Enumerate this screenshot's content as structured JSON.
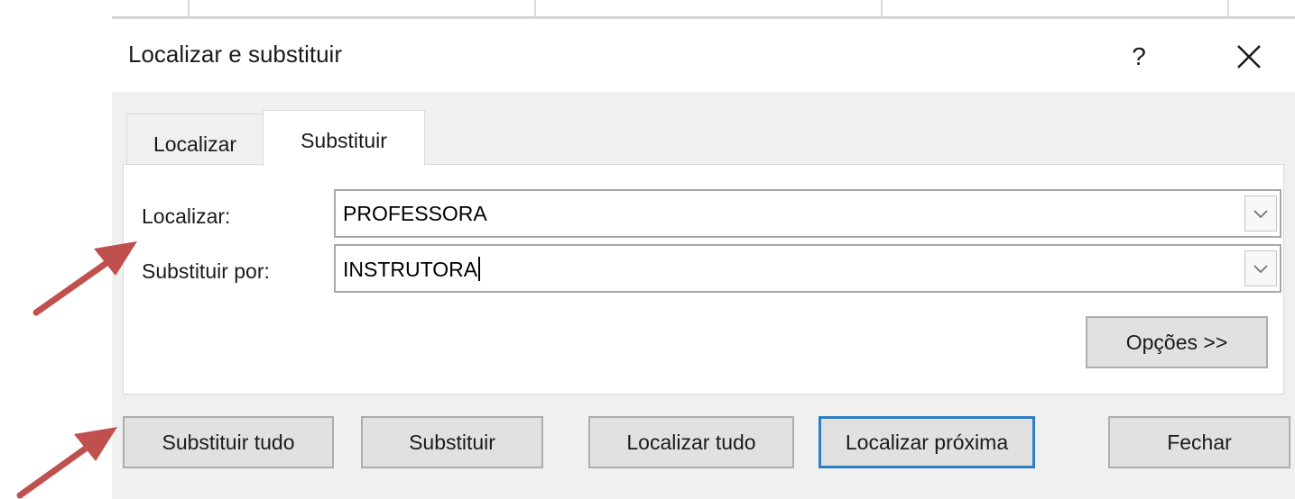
{
  "dialog": {
    "title": "Localizar e substituir",
    "help_label": "?",
    "close_icon": "close-icon"
  },
  "tabs": [
    {
      "label": "Localizar",
      "active": false
    },
    {
      "label": "Substituir",
      "active": true
    }
  ],
  "fields": {
    "find_label": "Localizar:",
    "find_value": "PROFESSORA",
    "replace_label": "Substituir por:",
    "replace_value": "INSTRUTORA"
  },
  "buttons": {
    "options": "Opções >>",
    "replace_all": "Substituir tudo",
    "replace": "Substituir",
    "find_all": "Localizar tudo",
    "find_next": "Localizar próxima",
    "close": "Fechar"
  },
  "colors": {
    "annotation_arrow": "#c0504d",
    "default_button_border": "#2f7fc8"
  }
}
